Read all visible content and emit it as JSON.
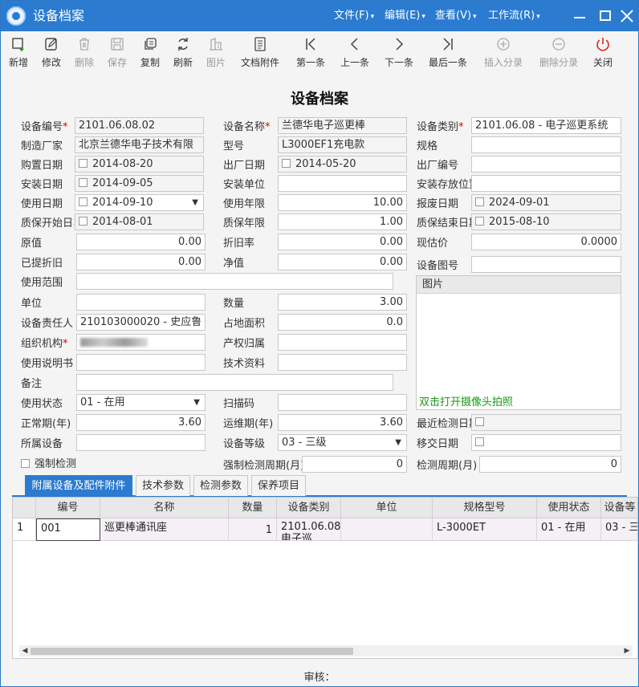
{
  "window": {
    "title": "设备档案",
    "menus": [
      "文件(F)",
      "编辑(E)",
      "查看(V)",
      "工作流(R)"
    ]
  },
  "toolbar": {
    "items": [
      {
        "label": "新增",
        "icon": "add-icon",
        "enabled": true
      },
      {
        "label": "修改",
        "icon": "edit-icon",
        "enabled": true
      },
      {
        "label": "删除",
        "icon": "trash-icon",
        "enabled": false
      },
      {
        "label": "保存",
        "icon": "save-icon",
        "enabled": false
      },
      {
        "label": "复制",
        "icon": "copy-icon",
        "enabled": true
      },
      {
        "label": "刷新",
        "icon": "refresh-icon",
        "enabled": true
      },
      {
        "label": "图片",
        "icon": "picture-icon",
        "enabled": false
      },
      {
        "label": "文档附件",
        "icon": "document-icon",
        "enabled": true
      },
      {
        "label": "第一条",
        "icon": "first-record-icon",
        "enabled": true
      },
      {
        "label": "上一条",
        "icon": "previous-record-icon",
        "enabled": true
      },
      {
        "label": "下一条",
        "icon": "next-record-icon",
        "enabled": true
      },
      {
        "label": "最后一条",
        "icon": "last-record-icon",
        "enabled": true
      },
      {
        "label": "插入分录",
        "icon": "insert-row-icon",
        "enabled": false
      },
      {
        "label": "删除分录",
        "icon": "delete-row-icon",
        "enabled": false
      },
      {
        "label": "关闭",
        "icon": "power-icon",
        "enabled": true
      }
    ]
  },
  "form": {
    "title": "设备档案",
    "device_no": {
      "label": "设备编号",
      "value": "2101.06.08.02"
    },
    "device_name": {
      "label": "设备名称",
      "value": "兰德华电子巡更棒"
    },
    "device_category": {
      "label": "设备类别",
      "value": "2101.06.08 - 电子巡更系统"
    },
    "manufacturer": {
      "label": "制造厂家",
      "value": "北京兰德华电子技术有限"
    },
    "model": {
      "label": "型号",
      "value": "L3000EF1充电款"
    },
    "spec": {
      "label": "规格",
      "value": ""
    },
    "purchase_date": {
      "label": "购置日期",
      "value": "2014-08-20"
    },
    "factory_date": {
      "label": "出厂日期",
      "value": "2014-05-20"
    },
    "factory_no": {
      "label": "出厂编号",
      "value": ""
    },
    "install_date": {
      "label": "安装日期",
      "value": "2014-09-05"
    },
    "install_unit": {
      "label": "安装单位",
      "value": ""
    },
    "install_location": {
      "label": "安装存放位置",
      "value": ""
    },
    "use_date": {
      "label": "使用日期",
      "value": "2014-09-10"
    },
    "use_years": {
      "label": "使用年限",
      "value": "10.00"
    },
    "scrap_date": {
      "label": "报废日期",
      "value": "2024-09-01"
    },
    "warranty_start": {
      "label": "质保开始日期",
      "value": "2014-08-01"
    },
    "warranty_years": {
      "label": "质保年限",
      "value": "1.00"
    },
    "warranty_end": {
      "label": "质保结束日期",
      "value": "2015-08-10"
    },
    "original_value": {
      "label": "原值",
      "value": "0.00"
    },
    "depreciation_rate": {
      "label": "折旧率",
      "value": "0.00"
    },
    "current_value": {
      "label": "现估价",
      "value": "0.0000"
    },
    "accum_depreciation": {
      "label": "已提折旧",
      "value": "0.00"
    },
    "net_value": {
      "label": "净值",
      "value": "0.00"
    },
    "drawing_no": {
      "label": "设备图号",
      "value": ""
    },
    "use_scope": {
      "label": "使用范围",
      "value": ""
    },
    "unit": {
      "label": "单位",
      "value": ""
    },
    "quantity": {
      "label": "数量",
      "value": "3.00"
    },
    "responsible": {
      "label": "设备责任人",
      "value": "210103000020 - 史应鲁"
    },
    "floor_area": {
      "label": "占地面积",
      "value": "0.0"
    },
    "org": {
      "label": "组织机构"
    },
    "property_owner": {
      "label": "产权归属",
      "value": ""
    },
    "manual": {
      "label": "使用说明书",
      "value": ""
    },
    "tech_data": {
      "label": "技术资料",
      "value": ""
    },
    "remark": {
      "label": "备注",
      "value": ""
    },
    "use_status": {
      "label": "使用状态",
      "value": "01 - 在用"
    },
    "scan_code": {
      "label": "扫描码",
      "value": ""
    },
    "normal_period": {
      "label": "正常期(年)",
      "value": "3.60"
    },
    "maintenance_period": {
      "label": "运维期(年)",
      "value": "3.60"
    },
    "last_check_date": {
      "label": "最近检测日期",
      "value": ""
    },
    "parent_device": {
      "label": "所属设备",
      "value": ""
    },
    "device_level": {
      "label": "设备等级",
      "value": "03 - 三级"
    },
    "transfer_date": {
      "label": "移交日期",
      "value": ""
    },
    "force_check": {
      "label": "强制检测"
    },
    "force_check_cycle": {
      "label": "强制检测周期(月)",
      "value": "0"
    },
    "check_cycle": {
      "label": "检测周期(月)",
      "value": "0"
    }
  },
  "photo": {
    "header": "图片",
    "hint": "双击打开摄像头拍照"
  },
  "tabs": [
    "附属设备及配件附件",
    "技术参数",
    "检测参数",
    "保养项目"
  ],
  "grid": {
    "columns": [
      "编号",
      "名称",
      "数量",
      "设备类别",
      "单位",
      "规格型号",
      "使用状态",
      "设备等"
    ],
    "rows": [
      {
        "index": "1",
        "cells": [
          "001",
          "巡更棒通讯座",
          "1",
          "2101.06.08 电子巡",
          "",
          "L-3000ET",
          "01 - 在用",
          "03 - 三"
        ]
      }
    ]
  },
  "footer": {
    "audit_label": "审核："
  },
  "colors": {
    "title_bar": "#2b7bd0",
    "required_mark": "#dd0000",
    "hint_text": "#1a9a1a"
  }
}
